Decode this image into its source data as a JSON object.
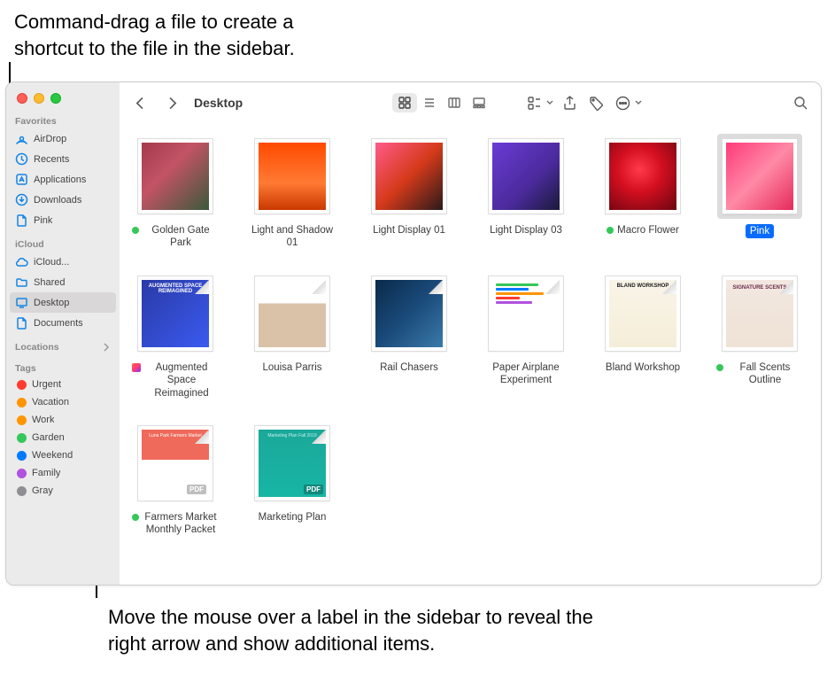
{
  "annotations": {
    "top": "Command-drag a file to create a shortcut to the file in the sidebar.",
    "bottom": "Move the mouse over a label in the sidebar to reveal the right arrow and show additional items."
  },
  "window": {
    "title": "Desktop"
  },
  "sidebar": {
    "sections": {
      "favorites": {
        "header": "Favorites",
        "items": [
          {
            "label": "AirDrop",
            "icon": "airdrop"
          },
          {
            "label": "Recents",
            "icon": "clock"
          },
          {
            "label": "Applications",
            "icon": "app"
          },
          {
            "label": "Downloads",
            "icon": "download"
          },
          {
            "label": "Pink",
            "icon": "doc"
          }
        ]
      },
      "icloud": {
        "header": "iCloud",
        "items": [
          {
            "label": "iCloud...",
            "icon": "cloud"
          },
          {
            "label": "Shared",
            "icon": "folder"
          },
          {
            "label": "Desktop",
            "icon": "desktop",
            "selected": true
          },
          {
            "label": "Documents",
            "icon": "doc"
          }
        ]
      },
      "locations": {
        "header": "Locations"
      },
      "tags": {
        "header": "Tags",
        "items": [
          {
            "label": "Urgent",
            "color": "#ff3b30"
          },
          {
            "label": "Vacation",
            "color": "#ff9500"
          },
          {
            "label": "Work",
            "color": "#ff9500"
          },
          {
            "label": "Garden",
            "color": "#34c759"
          },
          {
            "label": "Weekend",
            "color": "#007aff"
          },
          {
            "label": "Family",
            "color": "#af52de"
          },
          {
            "label": "Gray",
            "color": "#8e8e93"
          }
        ]
      }
    }
  },
  "files": [
    {
      "label": "Golden Gate Park",
      "thumb": "photo1",
      "tag": "#34c759"
    },
    {
      "label": "Light and Shadow 01",
      "thumb": "photo2"
    },
    {
      "label": "Light Display 01",
      "thumb": "photo3"
    },
    {
      "label": "Light Display 03",
      "thumb": "photo4"
    },
    {
      "label": "Macro Flower",
      "thumb": "photo5",
      "tag": "#34c759"
    },
    {
      "label": "Pink",
      "thumb": "photo6",
      "selected": true
    },
    {
      "label": "Augmented Space Reimagined",
      "thumb": "doc1",
      "icon": "app",
      "page": true
    },
    {
      "label": "Louisa Parris",
      "thumb": "doc2",
      "page": true
    },
    {
      "label": "Rail Chasers",
      "thumb": "doc3",
      "page": true
    },
    {
      "label": "Paper Airplane Experiment",
      "thumb": "doc4",
      "page": true
    },
    {
      "label": "Bland Workshop",
      "thumb": "doc5",
      "page": true
    },
    {
      "label": "Fall Scents Outline",
      "thumb": "doc6",
      "tag": "#34c759",
      "page": true
    },
    {
      "label": "Farmers Market Monthly Packet",
      "thumb": "pdf1",
      "tag": "#34c759",
      "pdf": true,
      "page": true
    },
    {
      "label": "Marketing Plan",
      "thumb": "pdf2",
      "pdf": true,
      "page": true
    }
  ],
  "thumbtext": {
    "doc1": "AUGMENTED SPACE REIMAGINED",
    "doc5": "BLAND WORKSHOP",
    "doc6": "SIGNATURE SCENTS",
    "pdf1": "Luna Park Farmers Market",
    "pdf2": "Marketing Plan Fall 2019",
    "pdfbadge": "PDF"
  }
}
